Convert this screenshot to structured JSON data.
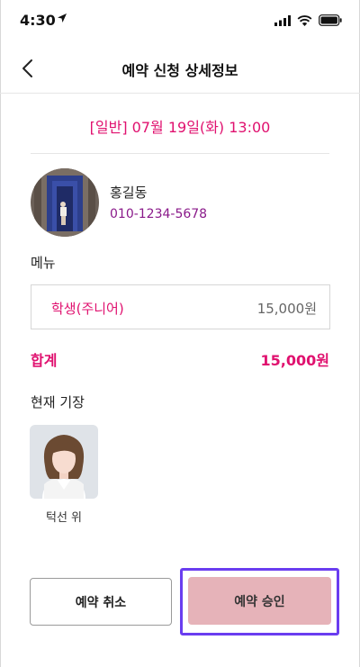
{
  "status_bar": {
    "time": "4:30",
    "icons": [
      "location-arrow-icon",
      "signal-icon",
      "wifi-icon",
      "battery-icon"
    ]
  },
  "header": {
    "title": "예약 신청 상세정보",
    "back_icon": "chevron-left-icon"
  },
  "reservation": {
    "date_text": "[일반] 07월 19일(화) 13:00"
  },
  "customer": {
    "name": "홍길동",
    "phone": "010-1234-5678"
  },
  "menu": {
    "label": "메뉴",
    "items": [
      {
        "name": "학생(주니어)",
        "price": "15,000원"
      }
    ]
  },
  "total": {
    "label": "합계",
    "value": "15,000원"
  },
  "designer": {
    "label": "현재 기장",
    "name": "턱선 위"
  },
  "actions": {
    "cancel_label": "예약 취소",
    "approve_label": "예약 승인"
  },
  "colors": {
    "accent": "#e0116f",
    "phone": "#8a1a8a",
    "approve_bg": "#e6b3b9",
    "highlight": "#6a3df0"
  }
}
